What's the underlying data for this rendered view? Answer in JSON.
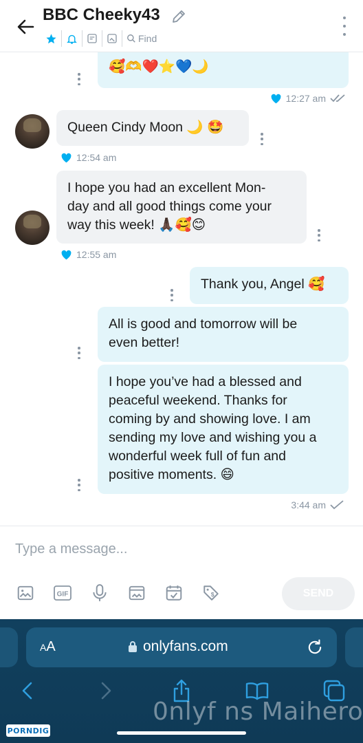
{
  "header": {
    "title": "BBC Cheeky43",
    "find_label": "Find"
  },
  "messages": [
    {
      "emoji": "🥰🫶❤️⭐💙🌙",
      "time": "12:27 am",
      "status": "read"
    },
    {
      "text": "Queen Cindy Moon 🌙 🤩",
      "time": "12:54 am"
    },
    {
      "text": "I hope you had an excellent Mon-day and all good things come your way this week! 🙏🏿🥰😊",
      "line1": "I hope you had an excellent Mon-",
      "line2": "day and all good things come your",
      "line3": "way this week! 🙏🏿🥰😊",
      "time": "12:55 am"
    },
    {
      "text": "Thank you, Angel 🥰"
    },
    {
      "line1": "All is good and tomorrow will be",
      "line2": "even better!"
    },
    {
      "line1": "I hope you’ve had a blessed and",
      "line2": "peaceful weekend. Thanks for",
      "line3": "coming by and showing love. I am",
      "line4": "sending my love and wishing you a",
      "line5": "wonderful week full of fun and",
      "line6": "positive moments. 😄",
      "time": "3:44 am",
      "status": "sent"
    }
  ],
  "composer": {
    "placeholder": "Type a message...",
    "send_label": "SEND"
  },
  "browser": {
    "text_size_label_small": "A",
    "text_size_label_large": "A",
    "url": "onlyfans.com",
    "watermark": "0nlyf ns Maihero",
    "logo": "PORNDIG"
  },
  "colors": {
    "accent": "#00aff0",
    "outgoing_bubble": "#e3f5fa",
    "incoming_bubble": "#f0f2f4",
    "browser_bar": "#11405e"
  }
}
